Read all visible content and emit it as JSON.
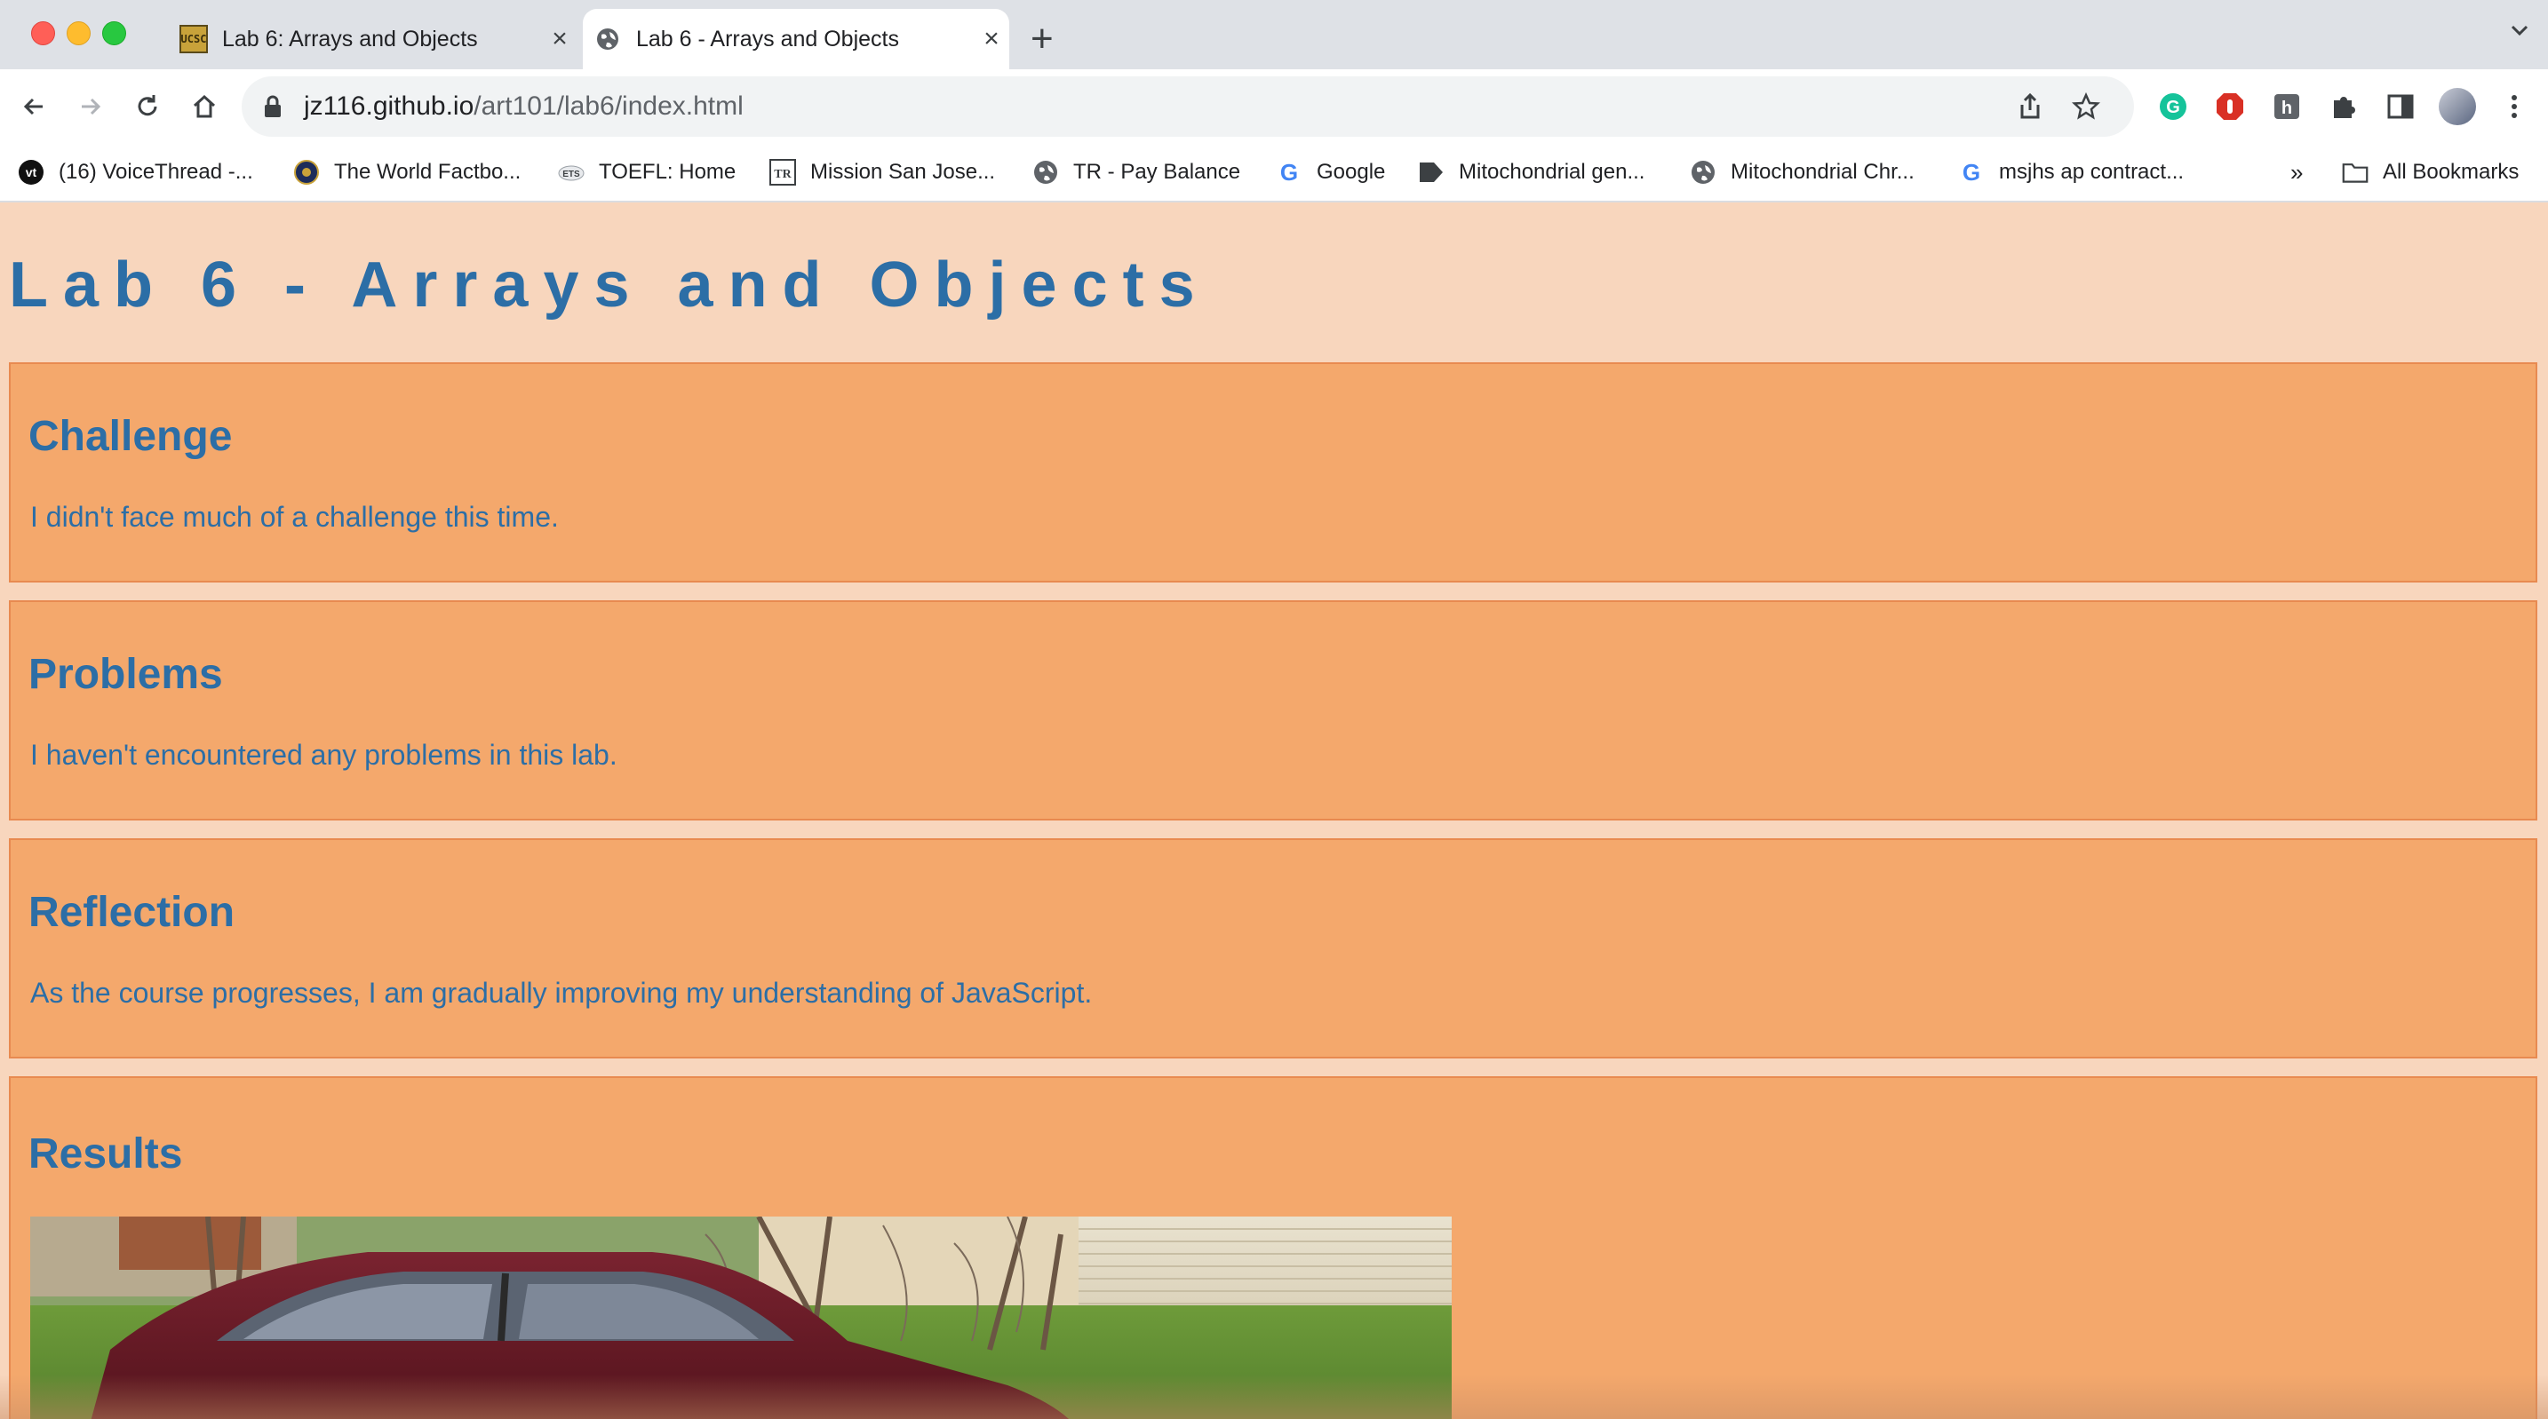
{
  "browser": {
    "tabs": [
      {
        "title": "Lab 6: Arrays and Objects",
        "favicon": "ucsc-favicon",
        "favicon_text": "UCSC"
      },
      {
        "title": "Lab 6 - Arrays and Objects",
        "favicon": "globe-icon",
        "active": true
      }
    ],
    "url_host": "jz116.github.io",
    "url_path": "/art101/lab6/index.html",
    "bookmarks": [
      {
        "label": "(16) VoiceThread -...",
        "icon": "voicethread-icon",
        "icon_text": "vt"
      },
      {
        "label": "The World Factbo...",
        "icon": "cia-seal-icon"
      },
      {
        "label": "TOEFL: Home",
        "icon": "ets-icon",
        "icon_text": "ETS"
      },
      {
        "label": "Mission San Jose...",
        "icon": "tr-icon",
        "icon_text": "TR"
      },
      {
        "label": "TR - Pay Balance",
        "icon": "globe-icon"
      },
      {
        "label": "Google",
        "icon": "google-icon",
        "icon_text": "G"
      },
      {
        "label": "Mitochondrial gen...",
        "icon": "bookmark-tag-icon"
      },
      {
        "label": "Mitochondrial Chr...",
        "icon": "globe-icon"
      },
      {
        "label": "msjhs ap contract...",
        "icon": "google-icon",
        "icon_text": "G"
      }
    ],
    "overflow_label": "»",
    "all_bookmarks_label": "All Bookmarks"
  },
  "page": {
    "title": "Lab 6 - Arrays and Objects",
    "sections": [
      {
        "heading": "Challenge",
        "text": "I didn't face much of a challenge this time."
      },
      {
        "heading": "Problems",
        "text": "I haven't encountered any problems in this lab."
      },
      {
        "heading": "Reflection",
        "text": "As the course progresses, I am gradually improving my understanding of JavaScript."
      },
      {
        "heading": "Results"
      }
    ]
  },
  "colors": {
    "page_bg": "#f8d6bd",
    "card_bg": "#f4a86c",
    "text": "#2c6ea6"
  }
}
